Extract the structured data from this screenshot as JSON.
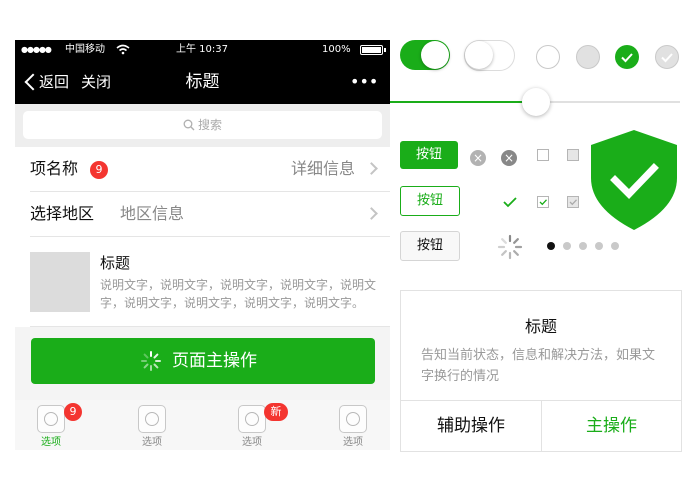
{
  "colors": {
    "brand_green": "#1aad19",
    "badge_red": "#f43530",
    "nav_black": "#000000"
  },
  "statusbar": {
    "carrier": "中国移动",
    "time": "上午 10:37",
    "battery": "100%"
  },
  "navbar": {
    "back_label": "返回",
    "close_label": "关闭",
    "title": "标题",
    "more_label": "•••"
  },
  "search": {
    "placeholder": "搜索"
  },
  "cells": {
    "item1": {
      "label": "项名称",
      "badge": "9",
      "detail": "详细信息"
    },
    "item2": {
      "label": "选择地区",
      "value": "地区信息"
    },
    "media": {
      "title": "标题",
      "desc": "说明文字，说明文字，说明文字，说明文字，说明文字，说明文字，说明文字，说明文字，说明文字。"
    }
  },
  "primary_action": {
    "label": "页面主操作"
  },
  "tabbar": {
    "items": [
      {
        "label": "选项",
        "badge": "9",
        "active": true
      },
      {
        "label": "选项",
        "badge": "",
        "active": false
      },
      {
        "label": "选项",
        "badge": "新",
        "active": false
      },
      {
        "label": "选项",
        "badge": "",
        "active": false
      }
    ]
  },
  "controls": {
    "switch_on": true,
    "switch_off": false,
    "slider_value": 0.5,
    "button_primary": "按钮",
    "button_plain": "按钮",
    "button_default": "按钮",
    "page_dots": {
      "count": 5,
      "active_index": 0
    }
  },
  "dialog": {
    "title": "标题",
    "message": "告知当前状态，信息和解决方法，如果文字换行的情况",
    "secondary_label": "辅助操作",
    "primary_label": "主操作"
  }
}
